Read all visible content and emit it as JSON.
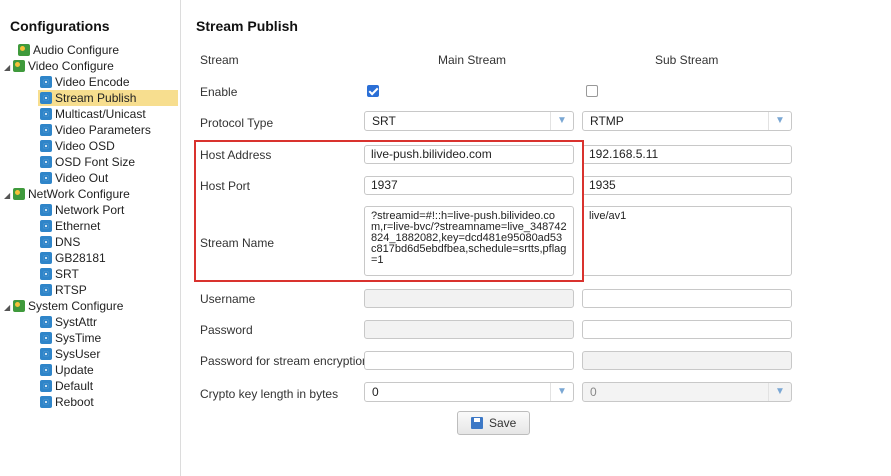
{
  "sidebar": {
    "title": "Configurations",
    "items": [
      {
        "label": "Audio Configure",
        "icon": "gear-group-icon",
        "level": 0
      },
      {
        "label": "Video Configure",
        "icon": "gear-group-icon",
        "level": 0,
        "expanded": true
      },
      {
        "label": "Video Encode",
        "icon": "gear-icon",
        "level": 1
      },
      {
        "label": "Stream Publish",
        "icon": "gear-icon",
        "level": 1,
        "selected": true
      },
      {
        "label": "Multicast/Unicast",
        "icon": "gear-icon",
        "level": 1
      },
      {
        "label": "Video Parameters",
        "icon": "gear-icon",
        "level": 1
      },
      {
        "label": "Video OSD",
        "icon": "gear-icon",
        "level": 1
      },
      {
        "label": "OSD Font Size",
        "icon": "gear-icon",
        "level": 1
      },
      {
        "label": "Video Out",
        "icon": "gear-icon",
        "level": 1
      },
      {
        "label": "NetWork Configure",
        "icon": "gear-group-icon",
        "level": 0,
        "expanded": true
      },
      {
        "label": "Network Port",
        "icon": "gear-icon",
        "level": 1
      },
      {
        "label": "Ethernet",
        "icon": "gear-icon",
        "level": 1
      },
      {
        "label": "DNS",
        "icon": "gear-icon",
        "level": 1
      },
      {
        "label": "GB28181",
        "icon": "gear-icon",
        "level": 1
      },
      {
        "label": "SRT",
        "icon": "gear-icon",
        "level": 1
      },
      {
        "label": "RTSP",
        "icon": "gear-icon",
        "level": 1
      },
      {
        "label": "System Configure",
        "icon": "gear-group-icon",
        "level": 0,
        "expanded": true
      },
      {
        "label": "SystAttr",
        "icon": "gear-icon",
        "level": 1
      },
      {
        "label": "SysTime",
        "icon": "gear-icon",
        "level": 1
      },
      {
        "label": "SysUser",
        "icon": "gear-icon",
        "level": 1
      },
      {
        "label": "Update",
        "icon": "gear-icon",
        "level": 1
      },
      {
        "label": "Default",
        "icon": "gear-icon",
        "level": 1
      },
      {
        "label": "Reboot",
        "icon": "gear-icon",
        "level": 1
      }
    ]
  },
  "main": {
    "title": "Stream Publish",
    "stream_label": "Stream",
    "main_stream_label": "Main Stream",
    "sub_stream_label": "Sub Stream",
    "labels": {
      "enable": "Enable",
      "protocol_type": "Protocol Type",
      "host_address": "Host Address",
      "host_port": "Host Port",
      "stream_name": "Stream Name",
      "username": "Username",
      "password": "Password",
      "password_encryption": "Password for stream encryption",
      "crypto_key_length": "Crypto key length in bytes"
    },
    "main_stream": {
      "enabled": true,
      "protocol": "SRT",
      "host_address": "live-push.bilivideo.com",
      "host_port": "1937",
      "stream_name": "?streamid=#!::h=live-push.bilivideo.com,r=live-bvc/?streamname=live_348742824_1882082,key=dcd481e95080ad53c817bd6d5ebdfbea,schedule=srtts,pflag=1",
      "username": "",
      "password": "",
      "password_encryption": "",
      "crypto_key_length": "0"
    },
    "sub_stream": {
      "enabled": false,
      "protocol": "RTMP",
      "host_address": "192.168.5.11",
      "host_port": "1935",
      "stream_name": "live/av1",
      "username": "",
      "password": "",
      "password_encryption": "",
      "crypto_key_length": "0"
    },
    "save_label": "Save"
  },
  "colors": {
    "highlight_border": "#d9322e",
    "selected_item": "#f7de8f",
    "checkbox_checked": "#2b6fd6"
  }
}
